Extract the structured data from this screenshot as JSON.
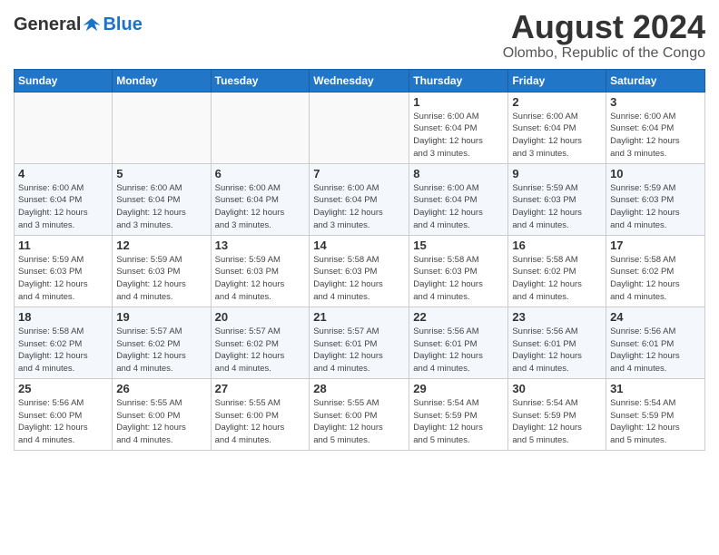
{
  "logo": {
    "general": "General",
    "blue": "Blue"
  },
  "title": {
    "month_year": "August 2024",
    "location": "Olombo, Republic of the Congo"
  },
  "headers": [
    "Sunday",
    "Monday",
    "Tuesday",
    "Wednesday",
    "Thursday",
    "Friday",
    "Saturday"
  ],
  "weeks": [
    [
      {
        "day": "",
        "info": ""
      },
      {
        "day": "",
        "info": ""
      },
      {
        "day": "",
        "info": ""
      },
      {
        "day": "",
        "info": ""
      },
      {
        "day": "1",
        "info": "Sunrise: 6:00 AM\nSunset: 6:04 PM\nDaylight: 12 hours\nand 3 minutes."
      },
      {
        "day": "2",
        "info": "Sunrise: 6:00 AM\nSunset: 6:04 PM\nDaylight: 12 hours\nand 3 minutes."
      },
      {
        "day": "3",
        "info": "Sunrise: 6:00 AM\nSunset: 6:04 PM\nDaylight: 12 hours\nand 3 minutes."
      }
    ],
    [
      {
        "day": "4",
        "info": "Sunrise: 6:00 AM\nSunset: 6:04 PM\nDaylight: 12 hours\nand 3 minutes."
      },
      {
        "day": "5",
        "info": "Sunrise: 6:00 AM\nSunset: 6:04 PM\nDaylight: 12 hours\nand 3 minutes."
      },
      {
        "day": "6",
        "info": "Sunrise: 6:00 AM\nSunset: 6:04 PM\nDaylight: 12 hours\nand 3 minutes."
      },
      {
        "day": "7",
        "info": "Sunrise: 6:00 AM\nSunset: 6:04 PM\nDaylight: 12 hours\nand 3 minutes."
      },
      {
        "day": "8",
        "info": "Sunrise: 6:00 AM\nSunset: 6:04 PM\nDaylight: 12 hours\nand 4 minutes."
      },
      {
        "day": "9",
        "info": "Sunrise: 5:59 AM\nSunset: 6:03 PM\nDaylight: 12 hours\nand 4 minutes."
      },
      {
        "day": "10",
        "info": "Sunrise: 5:59 AM\nSunset: 6:03 PM\nDaylight: 12 hours\nand 4 minutes."
      }
    ],
    [
      {
        "day": "11",
        "info": "Sunrise: 5:59 AM\nSunset: 6:03 PM\nDaylight: 12 hours\nand 4 minutes."
      },
      {
        "day": "12",
        "info": "Sunrise: 5:59 AM\nSunset: 6:03 PM\nDaylight: 12 hours\nand 4 minutes."
      },
      {
        "day": "13",
        "info": "Sunrise: 5:59 AM\nSunset: 6:03 PM\nDaylight: 12 hours\nand 4 minutes."
      },
      {
        "day": "14",
        "info": "Sunrise: 5:58 AM\nSunset: 6:03 PM\nDaylight: 12 hours\nand 4 minutes."
      },
      {
        "day": "15",
        "info": "Sunrise: 5:58 AM\nSunset: 6:03 PM\nDaylight: 12 hours\nand 4 minutes."
      },
      {
        "day": "16",
        "info": "Sunrise: 5:58 AM\nSunset: 6:02 PM\nDaylight: 12 hours\nand 4 minutes."
      },
      {
        "day": "17",
        "info": "Sunrise: 5:58 AM\nSunset: 6:02 PM\nDaylight: 12 hours\nand 4 minutes."
      }
    ],
    [
      {
        "day": "18",
        "info": "Sunrise: 5:58 AM\nSunset: 6:02 PM\nDaylight: 12 hours\nand 4 minutes."
      },
      {
        "day": "19",
        "info": "Sunrise: 5:57 AM\nSunset: 6:02 PM\nDaylight: 12 hours\nand 4 minutes."
      },
      {
        "day": "20",
        "info": "Sunrise: 5:57 AM\nSunset: 6:02 PM\nDaylight: 12 hours\nand 4 minutes."
      },
      {
        "day": "21",
        "info": "Sunrise: 5:57 AM\nSunset: 6:01 PM\nDaylight: 12 hours\nand 4 minutes."
      },
      {
        "day": "22",
        "info": "Sunrise: 5:56 AM\nSunset: 6:01 PM\nDaylight: 12 hours\nand 4 minutes."
      },
      {
        "day": "23",
        "info": "Sunrise: 5:56 AM\nSunset: 6:01 PM\nDaylight: 12 hours\nand 4 minutes."
      },
      {
        "day": "24",
        "info": "Sunrise: 5:56 AM\nSunset: 6:01 PM\nDaylight: 12 hours\nand 4 minutes."
      }
    ],
    [
      {
        "day": "25",
        "info": "Sunrise: 5:56 AM\nSunset: 6:00 PM\nDaylight: 12 hours\nand 4 minutes."
      },
      {
        "day": "26",
        "info": "Sunrise: 5:55 AM\nSunset: 6:00 PM\nDaylight: 12 hours\nand 4 minutes."
      },
      {
        "day": "27",
        "info": "Sunrise: 5:55 AM\nSunset: 6:00 PM\nDaylight: 12 hours\nand 4 minutes."
      },
      {
        "day": "28",
        "info": "Sunrise: 5:55 AM\nSunset: 6:00 PM\nDaylight: 12 hours\nand 5 minutes."
      },
      {
        "day": "29",
        "info": "Sunrise: 5:54 AM\nSunset: 5:59 PM\nDaylight: 12 hours\nand 5 minutes."
      },
      {
        "day": "30",
        "info": "Sunrise: 5:54 AM\nSunset: 5:59 PM\nDaylight: 12 hours\nand 5 minutes."
      },
      {
        "day": "31",
        "info": "Sunrise: 5:54 AM\nSunset: 5:59 PM\nDaylight: 12 hours\nand 5 minutes."
      }
    ]
  ]
}
